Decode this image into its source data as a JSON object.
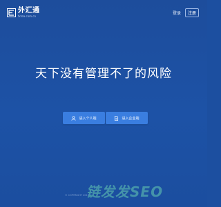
{
  "header": {
    "logo_name": "外汇通",
    "logo_sub": "fxtea.com.cn",
    "login_label": "登录",
    "register_label": "注册"
  },
  "hero": {
    "title": "天下没有管理不了的风险"
  },
  "actions": {
    "personal_label": "进入个人端",
    "company_label": "进入企业端"
  },
  "footer": {
    "copyright": "© COPYRIGHT 2019",
    "watermark": "链发发SEO"
  },
  "colors": {
    "background": "#1d4f9f",
    "button": "#3a7ee0",
    "watermark": "#6ed7b4"
  }
}
